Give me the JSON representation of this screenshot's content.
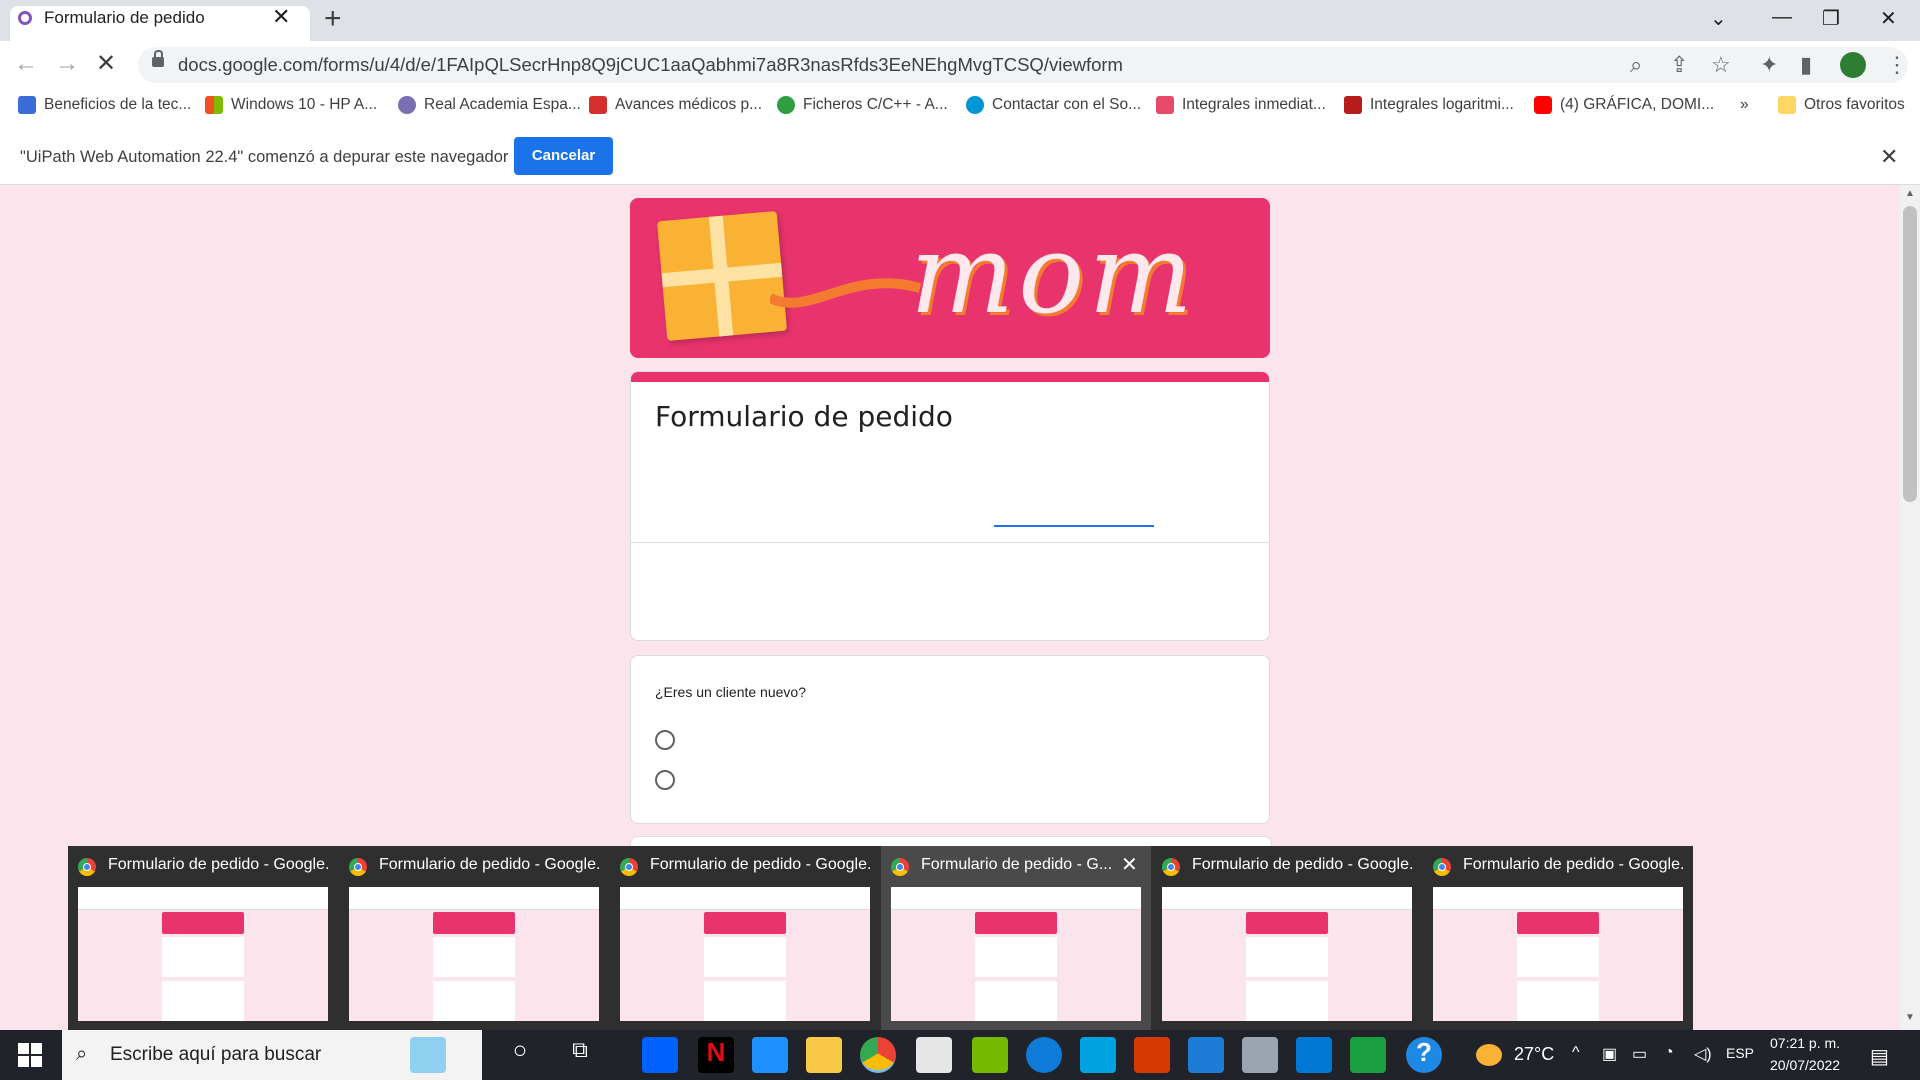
{
  "tab": {
    "title": "Formulario de pedido",
    "close": "✕",
    "new_tab": "+"
  },
  "window_controls": {
    "dropdown": "⌄",
    "minimize": "—",
    "restore": "❐",
    "close": "✕"
  },
  "address_bar": {
    "url": "docs.google.com/forms/u/4/d/e/1FAIpQLSecrHnp8Q9jCUC1aaQabhmi7a8R3nasRfds3EeNEhgMvgTCSQ/viewform"
  },
  "nav": {
    "back": "←",
    "forward": "→",
    "stop": "✕"
  },
  "bookmarks": [
    {
      "label": "Beneficios de la tec...",
      "color": "#3b6dd8"
    },
    {
      "label": "Windows 10 - HP A...",
      "color": "#f25022"
    },
    {
      "label": "Real Academia Espa...",
      "color": "#7a6fb0"
    },
    {
      "label": "Avances médicos p...",
      "color": "#d32f2f"
    },
    {
      "label": "Ficheros C/C++ - A...",
      "color": "#2e9e3f"
    },
    {
      "label": "Contactar con el So...",
      "color": "#0096d6"
    },
    {
      "label": "Integrales inmediat...",
      "color": "#e64a6a"
    },
    {
      "label": "Integrales logaritmi...",
      "color": "#b71c1c"
    },
    {
      "label": "(4) GRÁFICA, DOMI...",
      "color": "#ff0000"
    }
  ],
  "bookmarks_more": "»",
  "other_bookmarks": "Otros favoritos",
  "infobar": {
    "message": "\"UiPath Web Automation 22.4\" comenzó a depurar este navegador",
    "cancel_label": "Cancelar",
    "close": "✕"
  },
  "banner": {
    "text": "mom"
  },
  "form": {
    "title": "Formulario de pedido",
    "question": "¿Eres un cliente nuevo?"
  },
  "previews": [
    {
      "title": "Formulario de pedido - Google..."
    },
    {
      "title": "Formulario de pedido - Google..."
    },
    {
      "title": "Formulario de pedido - Google..."
    },
    {
      "title": "Formulario de pedido - G..."
    },
    {
      "title": "Formulario de pedido - Google..."
    },
    {
      "title": "Formulario de pedido - Google..."
    }
  ],
  "taskbar": {
    "search_placeholder": "Escribe aquí para buscar",
    "temperature": "27°C",
    "language": "ESP",
    "time": "07:21 p. m.",
    "date": "20/07/2022"
  },
  "colors": {
    "accent": "#e8336d",
    "button_blue": "#1a73e8",
    "page_bg": "#fce4ec"
  }
}
